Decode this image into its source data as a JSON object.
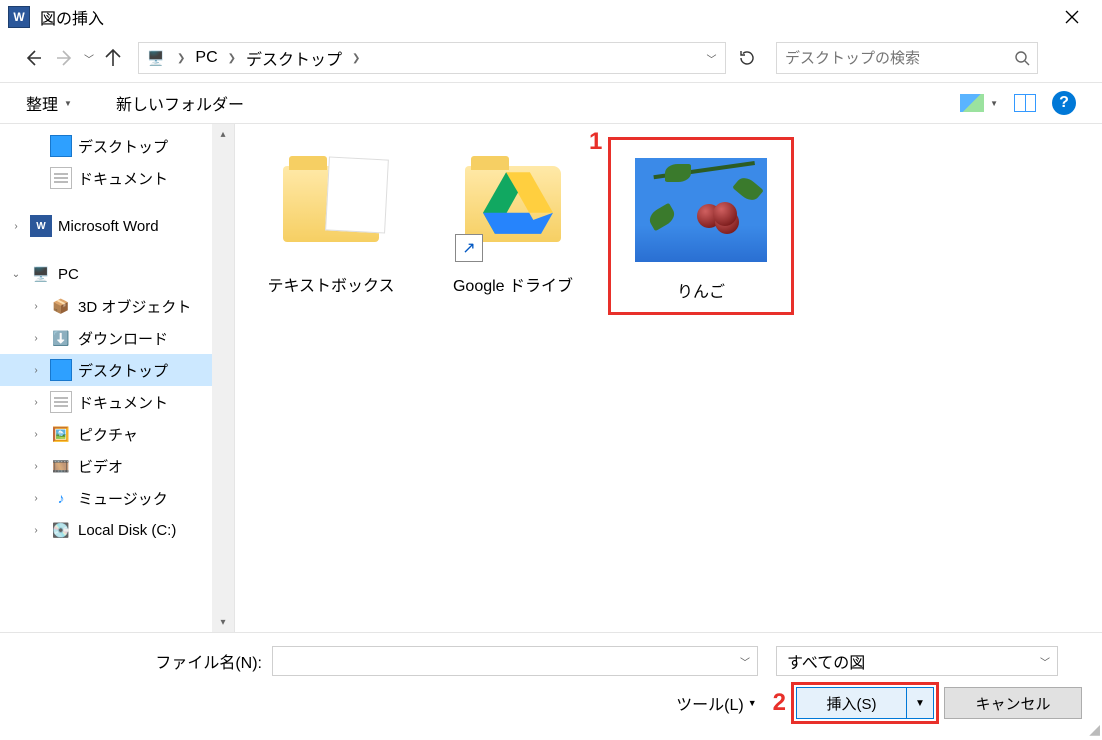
{
  "window": {
    "title": "図の挿入"
  },
  "nav": {
    "address_root_icon": "pc-icon",
    "crumbs": [
      "PC",
      "デスクトップ"
    ]
  },
  "search": {
    "placeholder": "デスクトップの検索"
  },
  "toolbar": {
    "organize": "整理",
    "new_folder": "新しいフォルダー"
  },
  "tree": {
    "items": [
      {
        "label": "デスクトップ",
        "icon": "desktop",
        "depth": 1,
        "tw": ""
      },
      {
        "label": "ドキュメント",
        "icon": "docs",
        "depth": 1,
        "tw": ""
      },
      {
        "label": "Microsoft Word",
        "icon": "word",
        "depth": 0,
        "tw": ">"
      },
      {
        "label": "PC",
        "icon": "pc",
        "depth": 0,
        "tw": "v"
      },
      {
        "label": "3D オブジェクト",
        "icon": "folder3d",
        "depth": 1,
        "tw": ">"
      },
      {
        "label": "ダウンロード",
        "icon": "dl",
        "depth": 1,
        "tw": ">"
      },
      {
        "label": "デスクトップ",
        "icon": "desktop",
        "depth": 1,
        "tw": ">",
        "sel": true
      },
      {
        "label": "ドキュメント",
        "icon": "docs",
        "depth": 1,
        "tw": ">"
      },
      {
        "label": "ピクチャ",
        "icon": "pics",
        "depth": 1,
        "tw": ">"
      },
      {
        "label": "ビデオ",
        "icon": "vid",
        "depth": 1,
        "tw": ">"
      },
      {
        "label": "ミュージック",
        "icon": "music",
        "depth": 1,
        "tw": ">"
      },
      {
        "label": "Local Disk (C:)",
        "icon": "disk",
        "depth": 1,
        "tw": ">"
      }
    ]
  },
  "items": [
    {
      "name": "テキストボックス",
      "kind": "folder-doc"
    },
    {
      "name": "Google ドライブ",
      "kind": "gdrive-shortcut"
    },
    {
      "name": "りんご",
      "kind": "photo",
      "highlight": true
    }
  ],
  "callouts": {
    "one": "1",
    "two": "2"
  },
  "bottom": {
    "filename_label": "ファイル名(N):",
    "filename_value": "",
    "filetype": "すべての図",
    "tools": "ツール(L)",
    "insert": "挿入(S)",
    "cancel": "キャンセル"
  }
}
